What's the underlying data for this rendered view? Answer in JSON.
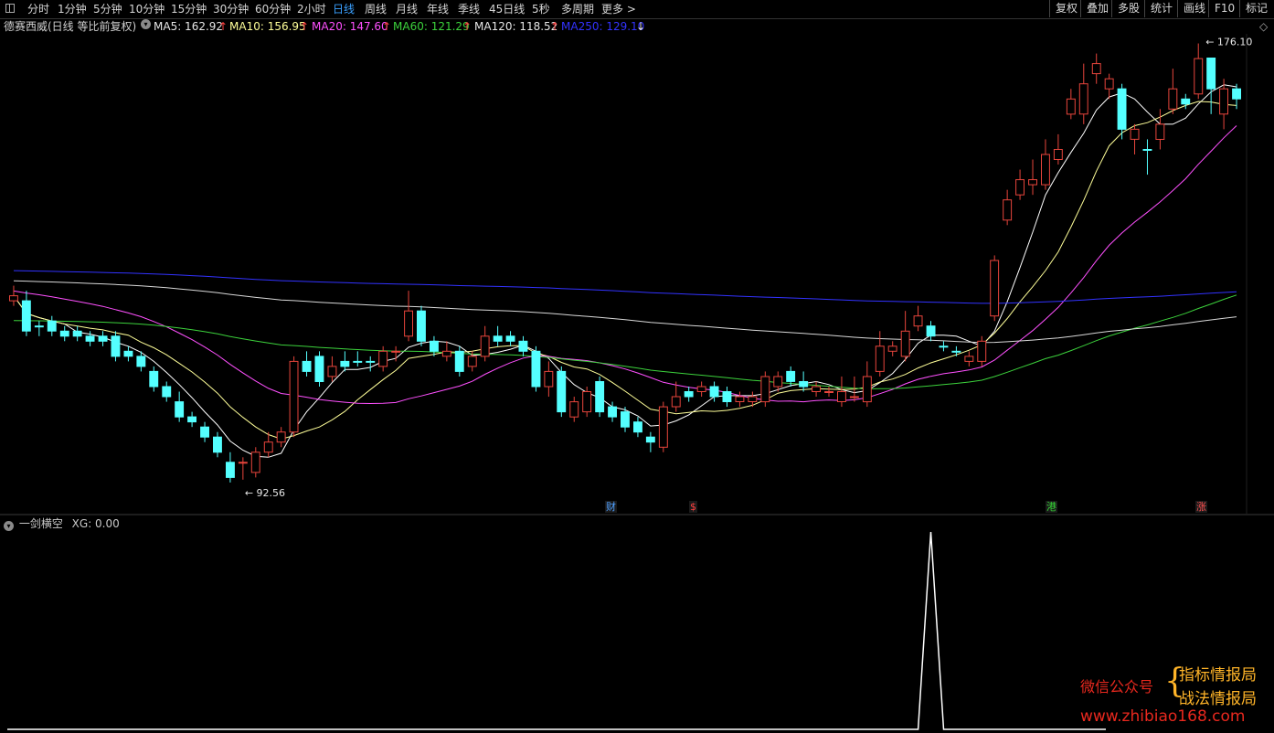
{
  "toolbar": {
    "periods": [
      "分时",
      "1分钟",
      "5分钟",
      "10分钟",
      "15分钟",
      "30分钟",
      "60分钟",
      "2小时",
      "日线",
      "周线",
      "月线",
      "年线",
      "季线",
      "45日线",
      "5秒",
      "多周期",
      "更多 >"
    ],
    "active_period": "日线",
    "right_buttons": [
      "复权",
      "叠加",
      "多股",
      "统计",
      "画线",
      "F10",
      "标记"
    ]
  },
  "info": {
    "title": "德赛西威(日线 等比前复权)",
    "ma5": "MA5: 162.92",
    "ma10": "MA10: 156.95",
    "ma20": "MA20: 147.60",
    "ma60": "MA60: 121.29",
    "ma120": "MA120: 118.52",
    "ma250": "MA250: 129.10",
    "up_arrow": "↑",
    "down_arrow": "↓"
  },
  "colors": {
    "up": "#e8453c",
    "down": "#54ffff",
    "ma5": "#ffffff",
    "ma10": "#ffff99",
    "ma20": "#ff50ff",
    "ma60": "#3cd23c",
    "ma120": "#ffffff",
    "ma250": "#3232ff",
    "indicator": "#ffffff"
  },
  "annotations": {
    "high_label": "176.10",
    "low_label": "92.56"
  },
  "event_markers": [
    {
      "text": "财",
      "color": "#4d9fff"
    },
    {
      "text": "$",
      "color": "#ff4040"
    },
    {
      "text": "港",
      "color": "#34d334"
    },
    {
      "text": "涨",
      "color": "#ff5050"
    }
  ],
  "indicator": {
    "name": "一剑横空",
    "value": "XG: 0.00"
  },
  "watermark": {
    "line1": "微信公众号",
    "line2": "指标情报局",
    "line3": "战法情报局",
    "url": "www.zhibiao168.com"
  },
  "chart_data": {
    "type": "candlestick",
    "price_range": [
      92.56,
      176.1
    ],
    "candles": [
      [
        128,
        129,
        127,
        131,
        "u"
      ],
      [
        128,
        122,
        121,
        130,
        "d"
      ],
      [
        123,
        123,
        121,
        124,
        "d"
      ],
      [
        124,
        122,
        121,
        125,
        "d"
      ],
      [
        122,
        121,
        120,
        123,
        "d"
      ],
      [
        122,
        121,
        120,
        123,
        "d"
      ],
      [
        121,
        120,
        119,
        122,
        "d"
      ],
      [
        121,
        120,
        119,
        122,
        "d"
      ],
      [
        121,
        117,
        116,
        122,
        "d"
      ],
      [
        118,
        117,
        116,
        119,
        "d"
      ],
      [
        117,
        115,
        114,
        118,
        "d"
      ],
      [
        114,
        111,
        110,
        115,
        "d"
      ],
      [
        111,
        109,
        108,
        112,
        "d"
      ],
      [
        108,
        105,
        104,
        110,
        "d"
      ],
      [
        105,
        104,
        103,
        106,
        "d"
      ],
      [
        103,
        101,
        100,
        104,
        "d"
      ],
      [
        101,
        98,
        97,
        102,
        "d"
      ],
      [
        96,
        93,
        92,
        98,
        "d"
      ],
      [
        96,
        96,
        92.56,
        97,
        "u"
      ],
      [
        94,
        98,
        93,
        99,
        "u"
      ],
      [
        98,
        100,
        97,
        102,
        "u"
      ],
      [
        100,
        102,
        99,
        103,
        "u"
      ],
      [
        102,
        116,
        101,
        117,
        "u"
      ],
      [
        116,
        114,
        113,
        118,
        "d"
      ],
      [
        117,
        112,
        111,
        118,
        "d"
      ],
      [
        113,
        115,
        112,
        117,
        "u"
      ],
      [
        116,
        115,
        114,
        118,
        "d"
      ],
      [
        116,
        116,
        115,
        118,
        "d"
      ],
      [
        116,
        116,
        114,
        117,
        "d"
      ],
      [
        115,
        118,
        114,
        119,
        "u"
      ],
      [
        118,
        118,
        116,
        119,
        "u"
      ],
      [
        121,
        126,
        120,
        130,
        "u"
      ],
      [
        126,
        120,
        119,
        127,
        "d"
      ],
      [
        120,
        118,
        117,
        121,
        "d"
      ],
      [
        118,
        117,
        116,
        120,
        "u"
      ],
      [
        118,
        114,
        113,
        119,
        "d"
      ],
      [
        115,
        117,
        114,
        118,
        "u"
      ],
      [
        117,
        121,
        116,
        123,
        "u"
      ],
      [
        121,
        120,
        119,
        123,
        "d"
      ],
      [
        121,
        120,
        119,
        122,
        "d"
      ],
      [
        120,
        118,
        117,
        121,
        "d"
      ],
      [
        118,
        111,
        110,
        119,
        "d"
      ],
      [
        111,
        114,
        109,
        116,
        "u"
      ],
      [
        114,
        106,
        105,
        115,
        "d"
      ],
      [
        105,
        108,
        104,
        109,
        "u"
      ],
      [
        106,
        110,
        105,
        111,
        "u"
      ],
      [
        112,
        106,
        105,
        113,
        "d"
      ],
      [
        107,
        105,
        104,
        108,
        "d"
      ],
      [
        106,
        103,
        102,
        107,
        "d"
      ],
      [
        104,
        102,
        101,
        105,
        "d"
      ],
      [
        101,
        100,
        98,
        102,
        "d"
      ],
      [
        99,
        107,
        98,
        108,
        "u"
      ],
      [
        107,
        109,
        106,
        112,
        "u"
      ],
      [
        110,
        109,
        108,
        111,
        "d"
      ],
      [
        110,
        111,
        109,
        112,
        "u"
      ],
      [
        111,
        109,
        108,
        112,
        "d"
      ],
      [
        110,
        108,
        107,
        111,
        "d"
      ],
      [
        108,
        109,
        107,
        110,
        "u"
      ],
      [
        108,
        109,
        107,
        110,
        "u"
      ],
      [
        108,
        113,
        107,
        114,
        "u"
      ],
      [
        111,
        113,
        110,
        114,
        "u"
      ],
      [
        114,
        112,
        111,
        115,
        "d"
      ],
      [
        112,
        111,
        110,
        114,
        "d"
      ],
      [
        110,
        111,
        109,
        112,
        "u"
      ],
      [
        110,
        110,
        109,
        111,
        "u"
      ],
      [
        110,
        108,
        107,
        113,
        "u"
      ],
      [
        109,
        109,
        108,
        113,
        "u"
      ],
      [
        108,
        113,
        107,
        116,
        "u"
      ],
      [
        114,
        119,
        113,
        122,
        "u"
      ],
      [
        118,
        119,
        117,
        120,
        "u"
      ],
      [
        117,
        122,
        116,
        126,
        "u"
      ],
      [
        123,
        125,
        122,
        127,
        "u"
      ],
      [
        123,
        121,
        120,
        124,
        "d"
      ],
      [
        119,
        119,
        118,
        120,
        "d"
      ],
      [
        118,
        118,
        117,
        119,
        "d"
      ],
      [
        116,
        117,
        115,
        118,
        "u"
      ],
      [
        116,
        120,
        115,
        121,
        "u"
      ],
      [
        125,
        136,
        124,
        137,
        "u"
      ],
      [
        144,
        148,
        143,
        150,
        "u"
      ],
      [
        149,
        152,
        148,
        154,
        "u"
      ],
      [
        151,
        152,
        149,
        156,
        "u"
      ],
      [
        151,
        157,
        150,
        160,
        "u"
      ],
      [
        156,
        158,
        155,
        161,
        "u"
      ],
      [
        165,
        168,
        164,
        170,
        "u"
      ],
      [
        165,
        171,
        163,
        175,
        "u"
      ],
      [
        173,
        175,
        171,
        177,
        "u"
      ],
      [
        172,
        170,
        168,
        173,
        "u"
      ],
      [
        170,
        162,
        160,
        171,
        "d"
      ],
      [
        160,
        162,
        157,
        163,
        "u"
      ],
      [
        158,
        158,
        153,
        160,
        "d"
      ],
      [
        160,
        163,
        158,
        166,
        "u"
      ],
      [
        166,
        170,
        165,
        174,
        "u"
      ],
      [
        167,
        168,
        166,
        169,
        "d"
      ],
      [
        169,
        176,
        168,
        179,
        "u"
      ],
      [
        176.1,
        170,
        165,
        176.1,
        "d"
      ],
      [
        165,
        170,
        162,
        172,
        "u"
      ],
      [
        170,
        168,
        166,
        171,
        "d"
      ]
    ],
    "indicator_values": {
      "baseline": 0,
      "spike_index": 72,
      "spike_value": 1
    }
  }
}
